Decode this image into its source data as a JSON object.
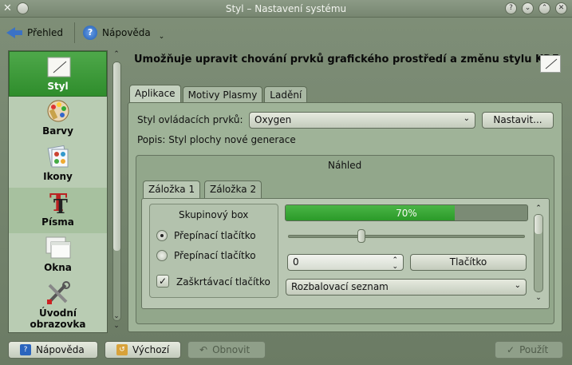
{
  "window": {
    "title": "Styl – Nastavení systému"
  },
  "toolbar": {
    "back_label": "Přehled",
    "help_label": "Nápověda"
  },
  "sidebar": {
    "items": [
      {
        "label": "Styl",
        "state": "active"
      },
      {
        "label": "Barvy"
      },
      {
        "label": "Ikony"
      },
      {
        "label": "Písma",
        "state": "hover"
      },
      {
        "label": "Okna"
      },
      {
        "label": "Úvodní\nobrazovka"
      }
    ]
  },
  "main": {
    "headline": "Umožňuje upravit chování prvků grafického prostředí a změnu stylu KDE",
    "tabs": [
      "Aplikace",
      "Motivy Plasmy",
      "Ladění"
    ],
    "style_label": "Styl ovládacích prvků:",
    "style_value": "Oxygen",
    "configure_label": "Nastavit...",
    "description": "Popis: Styl plochy nové generace",
    "preview": {
      "title": "Náhled",
      "tabs": [
        "Záložka 1",
        "Záložka 2"
      ],
      "groupbox_title": "Skupinový box",
      "radio1": "Přepínací tlačítko",
      "radio2": "Přepínací tlačítko",
      "checkbox": "Zaškrtávací tlačítko",
      "progress_text": "70%",
      "progress_fraction": 0.7,
      "slider_fraction": 0.31,
      "spin_value": "0",
      "button_label": "Tlačítko",
      "dropdown_value": "Rozbalovací seznam"
    }
  },
  "footer": {
    "help": "Nápověda",
    "defaults": "Výchozí",
    "reset": "Obnovit",
    "apply": "Použít"
  },
  "colors": {
    "accent_green": "#3a9a36",
    "chrome": "#7a8a73",
    "help_blue": "#2a64bd"
  }
}
